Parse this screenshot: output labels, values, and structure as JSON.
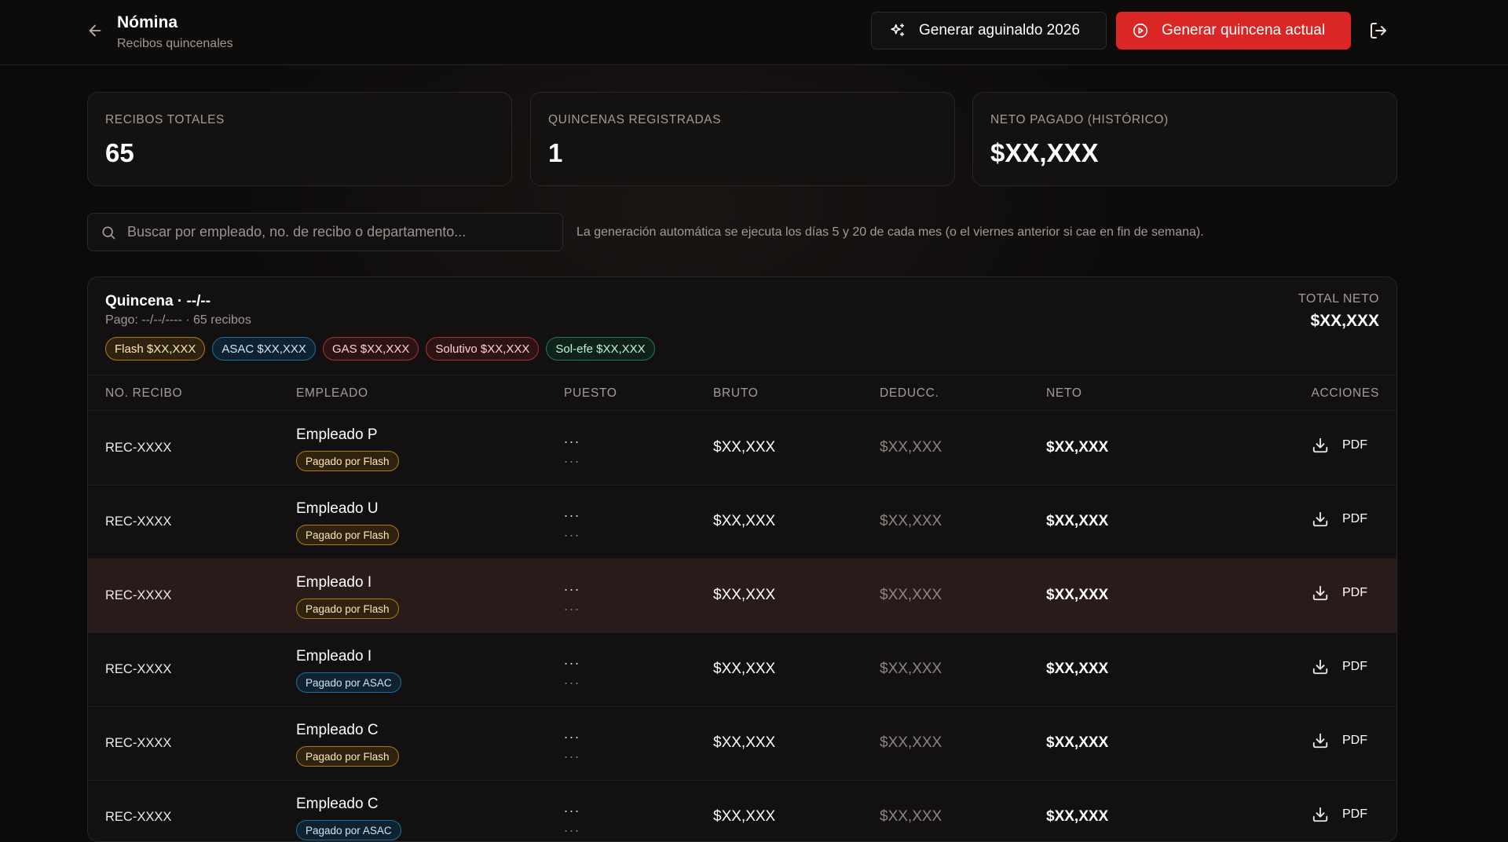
{
  "header": {
    "title": "Nómina",
    "subtitle": "Recibos quincenales",
    "btn_aguinaldo": "Generar aguinaldo 2026",
    "btn_quincena": "Generar quincena actual"
  },
  "stats": [
    {
      "label": "RECIBOS TOTALES",
      "value": "65"
    },
    {
      "label": "QUINCENAS REGISTRADAS",
      "value": "1"
    },
    {
      "label": "NETO PAGADO (HISTÓRICO)",
      "value": "$XX,XXX"
    }
  ],
  "search": {
    "placeholder": "Buscar por empleado, no. de recibo o departamento...",
    "value": ""
  },
  "auto_note": "La generación automática se ejecuta los días 5 y 20 de cada mes (o el viernes anterior si cae en fin de semana).",
  "quincena": {
    "title": "Quincena · --/--",
    "subtitle": "Pago: --/--/---- · 65 recibos",
    "total_label": "TOTAL NETO",
    "total_value": "$XX,XXX",
    "chips": [
      {
        "label": "Flash $XX,XXX",
        "kind": "flash"
      },
      {
        "label": "ASAC $XX,XXX",
        "kind": "asac"
      },
      {
        "label": "GAS $XX,XXX",
        "kind": "gas"
      },
      {
        "label": "Solutivo $XX,XXX",
        "kind": "solutivo"
      },
      {
        "label": "Sol-efe $XX,XXX",
        "kind": "solefe"
      }
    ]
  },
  "table": {
    "headers": {
      "recibo": "NO. RECIBO",
      "empleado": "EMPLEADO",
      "puesto": "PUESTO",
      "bruto": "BRUTO",
      "deducc": "DEDUCC.",
      "neto": "NETO",
      "acciones": "ACCIONES"
    },
    "rows": [
      {
        "recibo": "REC-XXXX",
        "name": "Empleado P",
        "badge": "Pagado por Flash",
        "badge_kind": "flash",
        "puesto1": "...",
        "puesto2": "...",
        "bruto": "$XX,XXX",
        "deducc": "$XX,XXX",
        "neto": "$XX,XXX",
        "action": "PDF",
        "highlighted": false
      },
      {
        "recibo": "REC-XXXX",
        "name": "Empleado U",
        "badge": "Pagado por Flash",
        "badge_kind": "flash",
        "puesto1": "...",
        "puesto2": "...",
        "bruto": "$XX,XXX",
        "deducc": "$XX,XXX",
        "neto": "$XX,XXX",
        "action": "PDF",
        "highlighted": false
      },
      {
        "recibo": "REC-XXXX",
        "name": "Empleado I",
        "badge": "Pagado por Flash",
        "badge_kind": "flash",
        "puesto1": "...",
        "puesto2": "...",
        "bruto": "$XX,XXX",
        "deducc": "$XX,XXX",
        "neto": "$XX,XXX",
        "action": "PDF",
        "highlighted": true
      },
      {
        "recibo": "REC-XXXX",
        "name": "Empleado I",
        "badge": "Pagado por ASAC",
        "badge_kind": "asac",
        "puesto1": "...",
        "puesto2": "...",
        "bruto": "$XX,XXX",
        "deducc": "$XX,XXX",
        "neto": "$XX,XXX",
        "action": "PDF",
        "highlighted": false
      },
      {
        "recibo": "REC-XXXX",
        "name": "Empleado C",
        "badge": "Pagado por Flash",
        "badge_kind": "flash",
        "puesto1": "...",
        "puesto2": "...",
        "bruto": "$XX,XXX",
        "deducc": "$XX,XXX",
        "neto": "$XX,XXX",
        "action": "PDF",
        "highlighted": false
      },
      {
        "recibo": "REC-XXXX",
        "name": "Empleado C",
        "badge": "Pagado por ASAC",
        "badge_kind": "asac",
        "puesto1": "...",
        "puesto2": "...",
        "bruto": "$XX,XXX",
        "deducc": "$XX,XXX",
        "neto": "$XX,XXX",
        "action": "PDF",
        "highlighted": false
      }
    ]
  },
  "colors": {
    "accent": "#dc2626",
    "background": "#0c0a0a",
    "panel": "#121010",
    "highlight_row": "#2a1b1b"
  },
  "icons": {
    "back": "arrow-left-icon",
    "aguinaldo": "sparkles-icon",
    "quincena": "play-circle-icon",
    "logout": "logout-icon",
    "search": "search-icon",
    "download": "download-icon"
  }
}
